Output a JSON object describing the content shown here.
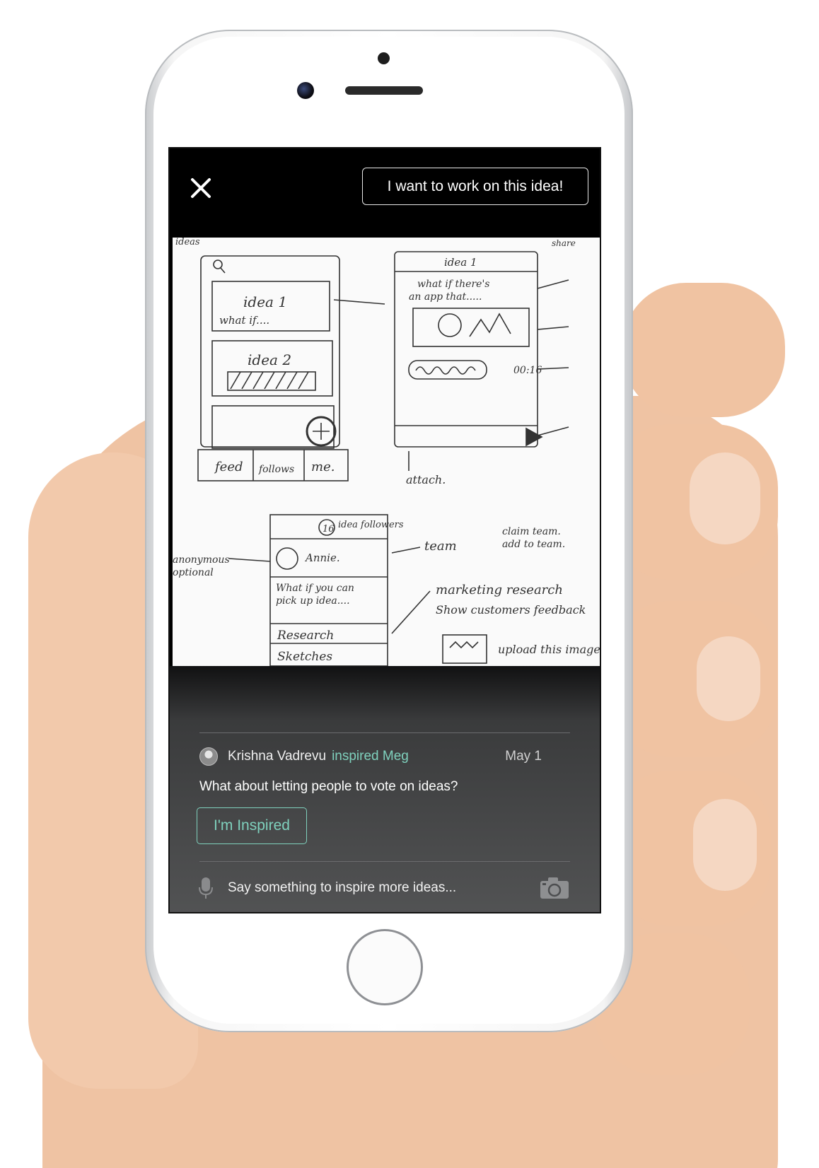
{
  "topbar": {
    "close_icon": "close-icon",
    "work_button_label": "I want to work on this idea!"
  },
  "sketch_notes": {
    "top_left": "ideas",
    "idea1_title": "idea 1",
    "idea1_body": "what if....",
    "idea2_title": "idea 2",
    "tab_feed": "feed",
    "tab_follows": "follows",
    "tab_me": "me.",
    "detail_title": "idea 1",
    "detail_body_1": "what if there's",
    "detail_body_2": "an app that.....",
    "timer": "00:16",
    "attach": "attach.",
    "share": "share",
    "followers_count": "16",
    "followers_label": "idea followers",
    "member_name": "Annie.",
    "post_text_1": "What if you can",
    "post_text_2": "pick up idea....",
    "research": "Research",
    "sketches": "Sketches",
    "team": "team",
    "claim_team": "claim team.",
    "add_team": "add to team.",
    "marketing": "marketing research",
    "feedback": "Show customers feedback",
    "upload": "upload this image",
    "anonymous": "anonymous",
    "optional": "optional"
  },
  "comment": {
    "avatar_icon": "avatar-icon",
    "author": "Krishna Vadrevu",
    "action": "inspired Meg",
    "date": "May 1",
    "text": "What about letting people to vote on ideas?"
  },
  "inspired_button_label": "I'm Inspired",
  "composer": {
    "mic_icon": "mic-icon",
    "placeholder": "Say something to inspire more ideas...",
    "camera_icon": "camera-icon"
  },
  "colors": {
    "accent": "#7fd1bd",
    "topbar": "#000000"
  }
}
